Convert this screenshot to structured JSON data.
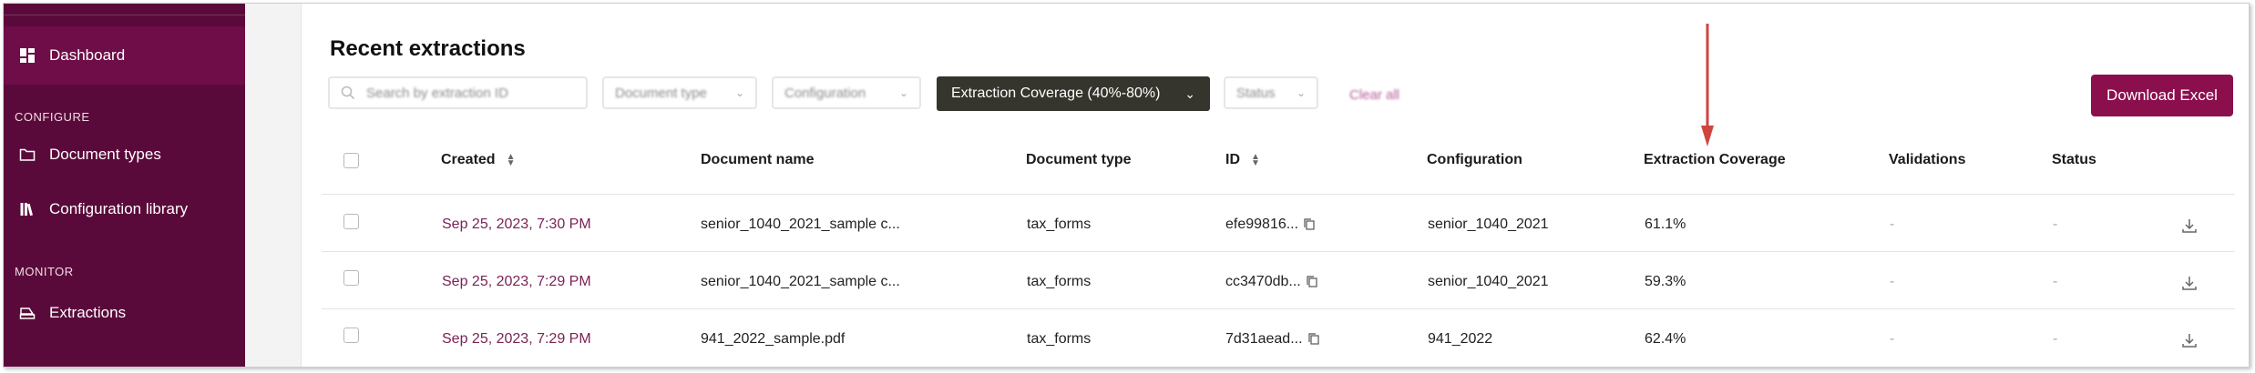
{
  "sidebar": {
    "dashboard": "Dashboard",
    "configure_section": "CONFIGURE",
    "document_types": "Document types",
    "configuration_library": "Configuration library",
    "monitor_section": "MONITOR",
    "extractions": "Extractions"
  },
  "main": {
    "title": "Recent extractions",
    "filters": {
      "search_placeholder": "Search by extraction ID",
      "document_type": "Document type",
      "configuration": "Configuration",
      "coverage": "Extraction Coverage (40%-80%)",
      "status": "Status",
      "clear_all": "Clear all"
    },
    "download_excel": "Download Excel"
  },
  "table": {
    "headers": {
      "created": "Created",
      "document_name": "Document name",
      "document_type": "Document type",
      "id": "ID",
      "configuration": "Configuration",
      "extraction_coverage": "Extraction Coverage",
      "validations": "Validations",
      "status": "Status"
    },
    "rows": [
      {
        "created": "Sep 25, 2023, 7:30 PM",
        "document_name": "senior_1040_2021_sample c...",
        "document_type": "tax_forms",
        "id": "efe99816...",
        "configuration": "senior_1040_2021",
        "coverage": "61.1%",
        "validations": "-",
        "status": "-"
      },
      {
        "created": "Sep 25, 2023, 7:29 PM",
        "document_name": "senior_1040_2021_sample c...",
        "document_type": "tax_forms",
        "id": "cc3470db...",
        "configuration": "senior_1040_2021",
        "coverage": "59.3%",
        "validations": "-",
        "status": "-"
      },
      {
        "created": "Sep 25, 2023, 7:29 PM",
        "document_name": "941_2022_sample.pdf",
        "document_type": "tax_forms",
        "id": "7d31aead...",
        "configuration": "941_2022",
        "coverage": "62.4%",
        "validations": "-",
        "status": "-"
      }
    ]
  },
  "colors": {
    "sidebar_bg": "#5a0a3a",
    "sidebar_active": "#6e0d47",
    "primary_button": "#8c0f4d",
    "active_filter_bg": "#35352d",
    "date_link": "#7a2356",
    "annotation_arrow": "#d0443f"
  }
}
